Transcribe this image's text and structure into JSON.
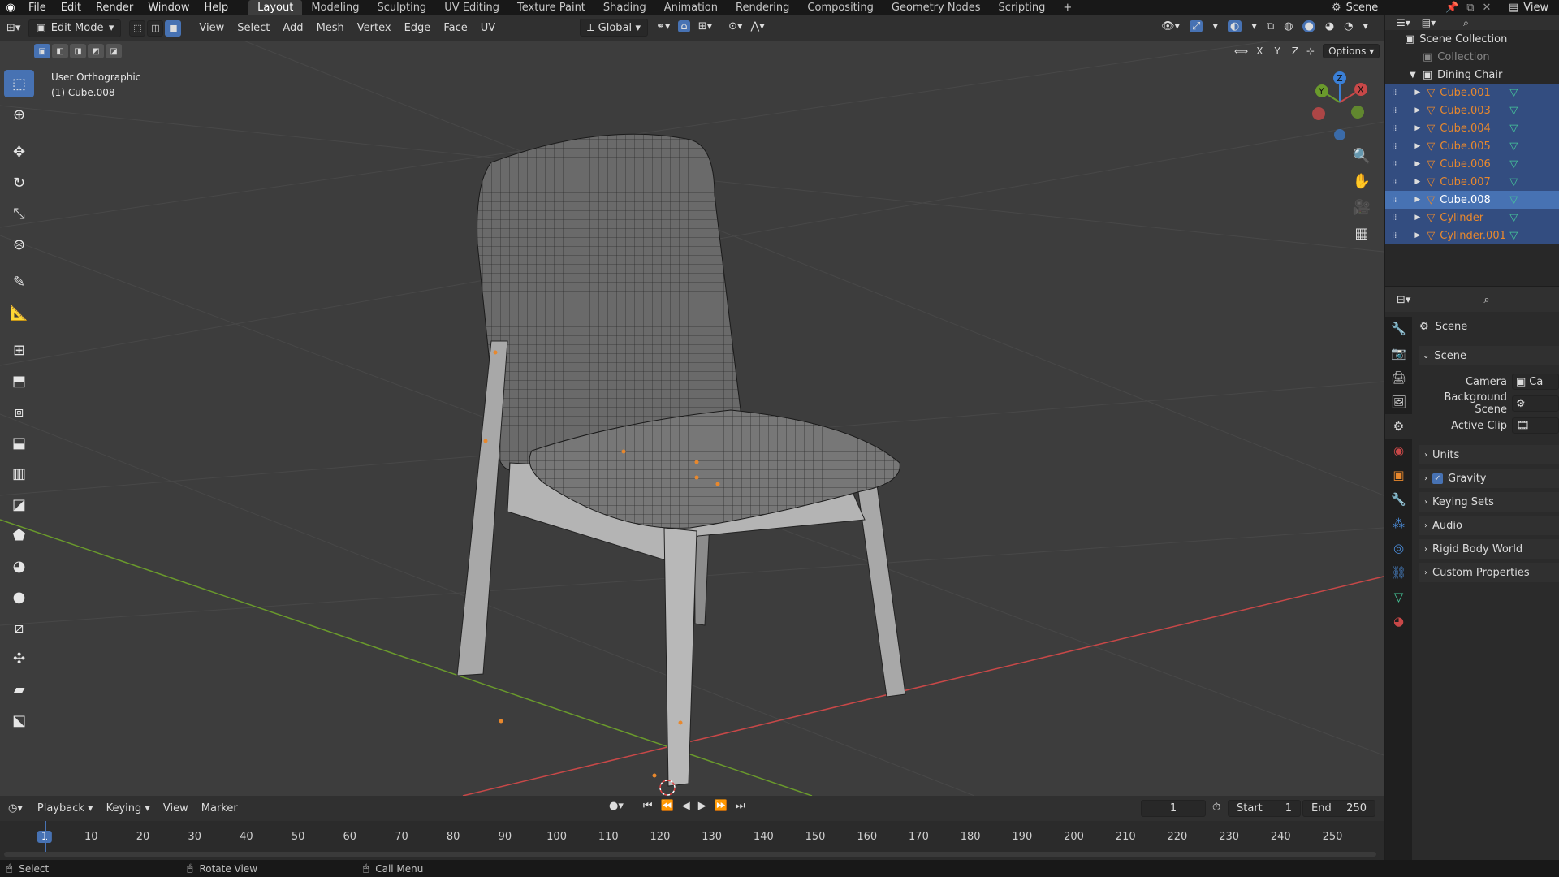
{
  "topbar": {
    "menus": [
      "File",
      "Edit",
      "Render",
      "Window",
      "Help"
    ],
    "workspaces": [
      "Layout",
      "Modeling",
      "Sculpting",
      "UV Editing",
      "Texture Paint",
      "Shading",
      "Animation",
      "Rendering",
      "Compositing",
      "Geometry Nodes",
      "Scripting"
    ],
    "add": "+",
    "scene": "Scene",
    "view_layer": "View"
  },
  "header": {
    "mode": "Edit Mode",
    "menus": [
      "View",
      "Select",
      "Add",
      "Mesh",
      "Vertex",
      "Edge",
      "Face",
      "UV"
    ],
    "orientation": "Global",
    "axes": [
      "X",
      "Y",
      "Z"
    ],
    "options": "Options"
  },
  "viewport": {
    "view_name": "User Orthographic",
    "object": "(1) Cube.008"
  },
  "gizmo": {
    "x": "X",
    "y": "Y",
    "z": "Z"
  },
  "outliner": {
    "root": "Scene Collection",
    "collection": "Collection",
    "group": "Dining Chair",
    "items": [
      "Cube.001",
      "Cube.003",
      "Cube.004",
      "Cube.005",
      "Cube.006",
      "Cube.007",
      "Cube.008",
      "Cylinder",
      "Cylinder.001"
    ]
  },
  "properties": {
    "title": "Scene",
    "section": "Scene",
    "camera_label": "Camera",
    "camera_value": "Ca",
    "bg_label": "Background Scene",
    "clip_label": "Active Clip",
    "panels": [
      "Units",
      "Gravity",
      "Keying Sets",
      "Audio",
      "Rigid Body World",
      "Custom Properties"
    ]
  },
  "timeline": {
    "menus": [
      "Playback",
      "Keying",
      "View",
      "Marker"
    ],
    "current": "1",
    "start_label": "Start",
    "start": "1",
    "end_label": "End",
    "end": "250",
    "ticks": [
      "1",
      "10",
      "20",
      "30",
      "40",
      "50",
      "60",
      "70",
      "80",
      "90",
      "100",
      "110",
      "120",
      "130",
      "140",
      "150",
      "160",
      "170",
      "180",
      "190",
      "200",
      "210",
      "220",
      "230",
      "240",
      "250"
    ]
  },
  "status": {
    "select": "Select",
    "rotate": "Rotate View",
    "menu": "Call Menu"
  },
  "colors": {
    "accent": "#4772b3",
    "object_orange": "#e8882d",
    "x_axis": "#c84848",
    "y_axis": "#6a9a2c",
    "z_axis": "#3a7fd6"
  }
}
